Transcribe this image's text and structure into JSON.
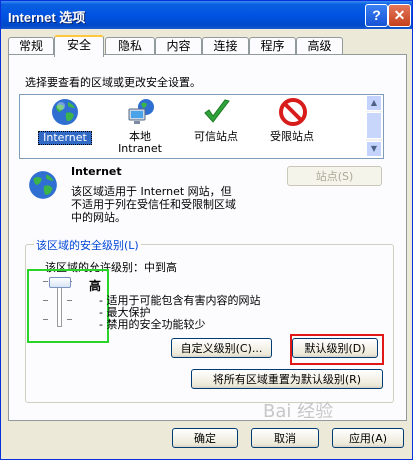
{
  "window": {
    "title": "Internet 选项",
    "help_label": "?",
    "close_label": "✕"
  },
  "tabs": [
    "常规",
    "安全",
    "隐私",
    "内容",
    "连接",
    "程序",
    "高级"
  ],
  "active_tab": "安全",
  "instruction": "选择要查看的区域或更改安全设置。",
  "zones": [
    {
      "label": "Internet",
      "icon": "globe-icon",
      "selected": true
    },
    {
      "label": "本地\nIntranet",
      "icon": "computer-globe-icon",
      "selected": false
    },
    {
      "label": "可信站点",
      "icon": "checkmark-icon",
      "selected": false
    },
    {
      "label": "受限站点",
      "icon": "no-entry-icon",
      "selected": false
    }
  ],
  "zone_detail": {
    "name": "Internet",
    "description_lines": [
      "该区域适用于 Internet 网站，但",
      "不适用于列在受信任和受限制区域",
      "中的网站。"
    ],
    "sites_button": "站点(S)"
  },
  "security_level": {
    "group_title": "该区域的安全级别(L)",
    "allowed_levels": "该区域的允许级别：中到高",
    "level_name": "高",
    "bullets": [
      "- 适用于可能包含有害内容的网站",
      "- 最大保护",
      "- 禁用的安全功能较少"
    ],
    "custom_button": "自定义级别(C)...",
    "default_button": "默认级别(D)",
    "reset_all_button": "将所有区域重置为默认级别(R)"
  },
  "footer": {
    "ok": "确定",
    "cancel": "取消",
    "apply": "应用(A)"
  },
  "watermark": "Bai 经验",
  "colors": {
    "titlebar": "#0054e3",
    "selection": "#316ac5",
    "highlight_green": "#2bd42b",
    "highlight_red": "#e01818"
  }
}
